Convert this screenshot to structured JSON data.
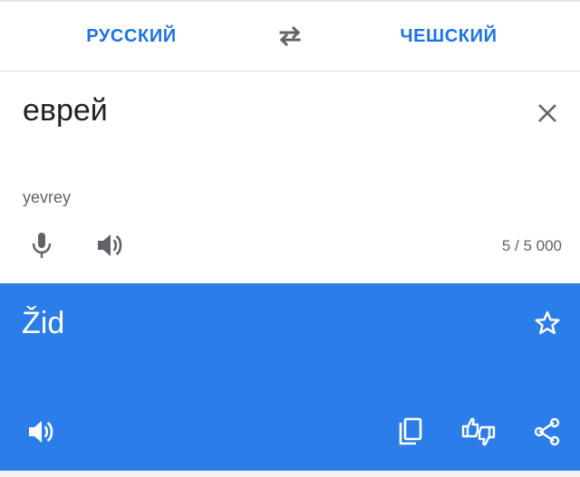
{
  "languages": {
    "source": "РУССКИЙ",
    "target": "ЧЕШСКИЙ"
  },
  "source": {
    "text": "еврей",
    "transliteration": "yevrey",
    "char_count": "5 / 5 000"
  },
  "result": {
    "text": "Žid"
  },
  "colors": {
    "accent": "#1a73e8",
    "result_background": "#2b7de9",
    "icon_gray": "#5f6368"
  },
  "icons": {
    "swap": "swap-languages-icon",
    "clear": "close-icon",
    "mic": "microphone-icon",
    "speak": "speaker-icon",
    "star": "star-outline-icon",
    "copy": "copy-icon",
    "feedback": "thumbs-feedback-icon",
    "share": "share-icon"
  }
}
